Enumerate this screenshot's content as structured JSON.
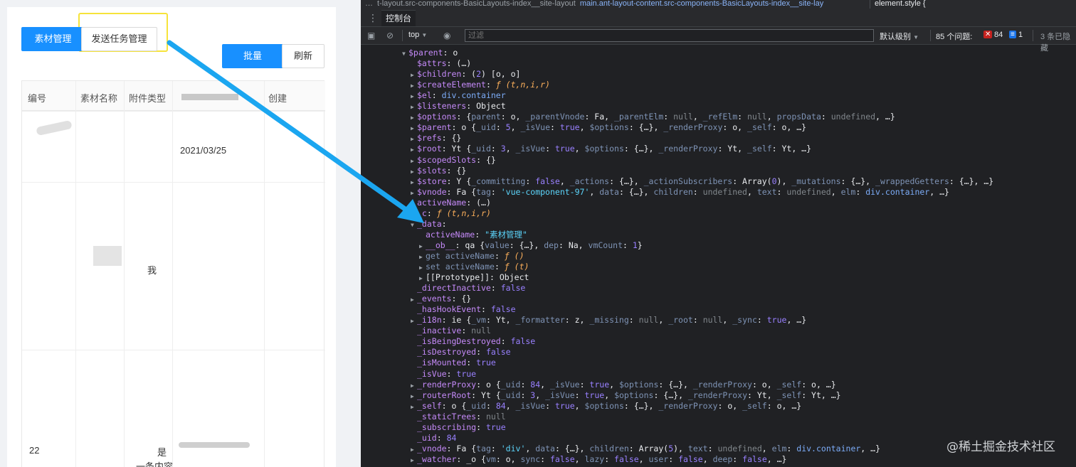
{
  "app": {
    "tabs": [
      {
        "label": "素材管理",
        "active": true
      },
      {
        "label": "发送任务管理",
        "active": false
      }
    ],
    "toolbar": {
      "primary_label": "批量",
      "refresh_label": "刷新"
    },
    "table": {
      "headers": [
        "编号",
        "素材名称",
        "附件类型",
        "",
        "创建"
      ],
      "fragments": {
        "row1_col3": "2021/03/25",
        "row2_col2": "我",
        "row3_id": "22",
        "row3_col2": "是",
        "row3_col2b": "一条内容"
      }
    }
  },
  "devtools": {
    "breadcrumb_1": "t-layout.src-components-BasicLayouts-index__site-layout",
    "breadcrumb_2": "main.ant-layout-content.src-components-BasicLayouts-index__site-lay",
    "style_label": "element.style {",
    "tab_label": "控制台",
    "context": "top",
    "filter_placeholder": "过滤",
    "level_label": "默认级别",
    "issues_label": "85 个问题:",
    "issues_errors": "84",
    "issues_info": "1",
    "hidden_label": "3 条已隐藏",
    "lines": [
      {
        "indent": 0,
        "tri": "▼",
        "key": "$parent",
        "val": "o"
      },
      {
        "indent": 1,
        "tri": "",
        "key": "$attrs",
        "val": "(…)"
      },
      {
        "indent": 1,
        "tri": "▶",
        "key": "$children",
        "val": "(2) [o, o]"
      },
      {
        "indent": 1,
        "tri": "▶",
        "key": "$createElement",
        "val": "ƒ (t,n,i,r)"
      },
      {
        "indent": 1,
        "tri": "▶",
        "key": "$el",
        "val": "div.container"
      },
      {
        "indent": 1,
        "tri": "▶",
        "key": "$listeners",
        "val": "Object"
      },
      {
        "indent": 1,
        "tri": "▶",
        "key": "$options",
        "val": "{parent: o, _parentVnode: Fa, _parentElm: null, _refElm: null, propsData: undefined, …}"
      },
      {
        "indent": 1,
        "tri": "▶",
        "key": "$parent",
        "val": "o {_uid: 5, _isVue: true, $options: {…}, _renderProxy: o, _self: o, …}"
      },
      {
        "indent": 1,
        "tri": "▶",
        "key": "$refs",
        "val": "{}"
      },
      {
        "indent": 1,
        "tri": "▶",
        "key": "$root",
        "val": "Yt {_uid: 3, _isVue: true, $options: {…}, _renderProxy: Yt, _self: Yt, …}"
      },
      {
        "indent": 1,
        "tri": "▶",
        "key": "$scopedSlots",
        "val": "{}"
      },
      {
        "indent": 1,
        "tri": "▶",
        "key": "$slots",
        "val": "{}"
      },
      {
        "indent": 1,
        "tri": "▶",
        "key": "$store",
        "val": "Y {_committing: false, _actions: {…}, _actionSubscribers: Array(0), _mutations: {…}, _wrappedGetters: {…}, …}"
      },
      {
        "indent": 1,
        "tri": "▶",
        "key": "$vnode",
        "val": "Fa {tag: 'vue-component-97', data: {…}, children: undefined, text: undefined, elm: div.container, …}"
      },
      {
        "indent": 1,
        "tri": "",
        "key": "activeName",
        "val": "(…)"
      },
      {
        "indent": 1,
        "tri": "▶",
        "key": "_c",
        "val": "ƒ (t,n,i,r)"
      },
      {
        "indent": 1,
        "tri": "▼",
        "key": "_data",
        "val": ""
      },
      {
        "indent": 2,
        "tri": "",
        "key": "activeName",
        "val": "\"素材管理\""
      },
      {
        "indent": 2,
        "tri": "▶",
        "key": "__ob__",
        "val": "qa {value: {…}, dep: Na, vmCount: 1}"
      },
      {
        "indent": 2,
        "tri": "▶",
        "key": "get activeName",
        "val": "ƒ ()"
      },
      {
        "indent": 2,
        "tri": "▶",
        "key": "set activeName",
        "val": "ƒ (t)"
      },
      {
        "indent": 2,
        "tri": "▶",
        "key": "[[Prototype]]",
        "val": "Object"
      },
      {
        "indent": 1,
        "tri": "",
        "key": "_directInactive",
        "val": "false"
      },
      {
        "indent": 1,
        "tri": "▶",
        "key": "_events",
        "val": "{}"
      },
      {
        "indent": 1,
        "tri": "",
        "key": "_hasHookEvent",
        "val": "false"
      },
      {
        "indent": 1,
        "tri": "▶",
        "key": "_i18n",
        "val": "ie {_vm: Yt, _formatter: z, _missing: null, _root: null, _sync: true, …}"
      },
      {
        "indent": 1,
        "tri": "",
        "key": "_inactive",
        "val": "null"
      },
      {
        "indent": 1,
        "tri": "",
        "key": "_isBeingDestroyed",
        "val": "false"
      },
      {
        "indent": 1,
        "tri": "",
        "key": "_isDestroyed",
        "val": "false"
      },
      {
        "indent": 1,
        "tri": "",
        "key": "_isMounted",
        "val": "true"
      },
      {
        "indent": 1,
        "tri": "",
        "key": "_isVue",
        "val": "true"
      },
      {
        "indent": 1,
        "tri": "▶",
        "key": "_renderProxy",
        "val": "o {_uid: 84, _isVue: true, $options: {…}, _renderProxy: o, _self: o, …}"
      },
      {
        "indent": 1,
        "tri": "▶",
        "key": "_routerRoot",
        "val": "Yt {_uid: 3, _isVue: true, $options: {…}, _renderProxy: Yt, _self: Yt, …}"
      },
      {
        "indent": 1,
        "tri": "▶",
        "key": "_self",
        "val": "o {_uid: 84, _isVue: true, $options: {…}, _renderProxy: o, _self: o, …}"
      },
      {
        "indent": 1,
        "tri": "",
        "key": "_staticTrees",
        "val": "null"
      },
      {
        "indent": 1,
        "tri": "",
        "key": "_subscribing",
        "val": "true"
      },
      {
        "indent": 1,
        "tri": "",
        "key": "_uid",
        "val": "84"
      },
      {
        "indent": 1,
        "tri": "▶",
        "key": "_vnode",
        "val": "Fa {tag: 'div', data: {…}, children: Array(5), text: undefined, elm: div.container, …}"
      },
      {
        "indent": 1,
        "tri": "▶",
        "key": "_watcher",
        "val": "_o {vm: o, sync: false, lazy: false, user: false, deep: false, …}"
      }
    ]
  },
  "watermark": "@稀土掘金技术社区",
  "colors": {
    "primary": "#1890ff",
    "highlight": "#f6e33a",
    "arrow": "#1ba6f0",
    "devtools_bg": "#202124"
  }
}
